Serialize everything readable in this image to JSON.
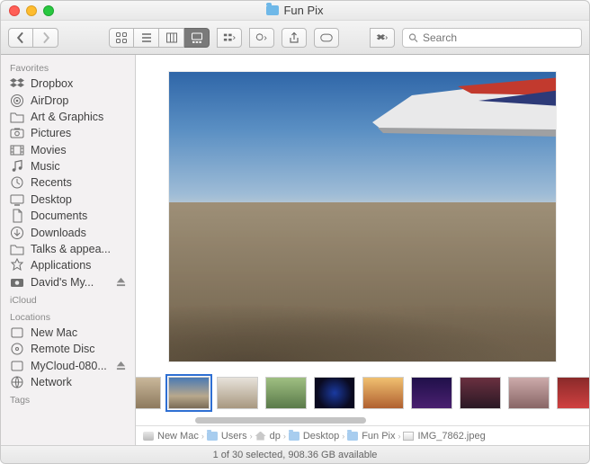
{
  "window": {
    "title": "Fun Pix"
  },
  "toolbar": {
    "search_placeholder": "Search"
  },
  "sidebar": {
    "sections": [
      {
        "header": "Favorites",
        "items": [
          {
            "icon": "dropbox",
            "label": "Dropbox"
          },
          {
            "icon": "airdrop",
            "label": "AirDrop"
          },
          {
            "icon": "folder",
            "label": "Art & Graphics"
          },
          {
            "icon": "pictures",
            "label": "Pictures"
          },
          {
            "icon": "movies",
            "label": "Movies"
          },
          {
            "icon": "music",
            "label": "Music"
          },
          {
            "icon": "recents",
            "label": "Recents"
          },
          {
            "icon": "desktop",
            "label": "Desktop"
          },
          {
            "icon": "documents",
            "label": "Documents"
          },
          {
            "icon": "downloads",
            "label": "Downloads"
          },
          {
            "icon": "folder",
            "label": "Talks & appea..."
          },
          {
            "icon": "apps",
            "label": "Applications"
          },
          {
            "icon": "camera",
            "label": "David's My...",
            "eject": true
          }
        ]
      },
      {
        "header": "iCloud",
        "items": []
      },
      {
        "header": "Locations",
        "items": [
          {
            "icon": "disk",
            "label": "New Mac"
          },
          {
            "icon": "cd",
            "label": "Remote Disc"
          },
          {
            "icon": "disk",
            "label": "MyCloud-080...",
            "eject": true
          },
          {
            "icon": "globe",
            "label": "Network"
          }
        ]
      },
      {
        "header": "Tags",
        "items": []
      }
    ]
  },
  "path": {
    "segments": [
      {
        "icon": "disk",
        "label": "New Mac"
      },
      {
        "icon": "fold",
        "label": "Users"
      },
      {
        "icon": "home",
        "label": "dp"
      },
      {
        "icon": "fold",
        "label": "Desktop"
      },
      {
        "icon": "fold",
        "label": "Fun Pix"
      },
      {
        "icon": "img",
        "label": "IMG_7862.jpeg"
      }
    ]
  },
  "status": {
    "text": "1 of 30 selected, 908.36 GB available"
  },
  "thumbnails": {
    "count": 11,
    "selected_index": 1
  }
}
